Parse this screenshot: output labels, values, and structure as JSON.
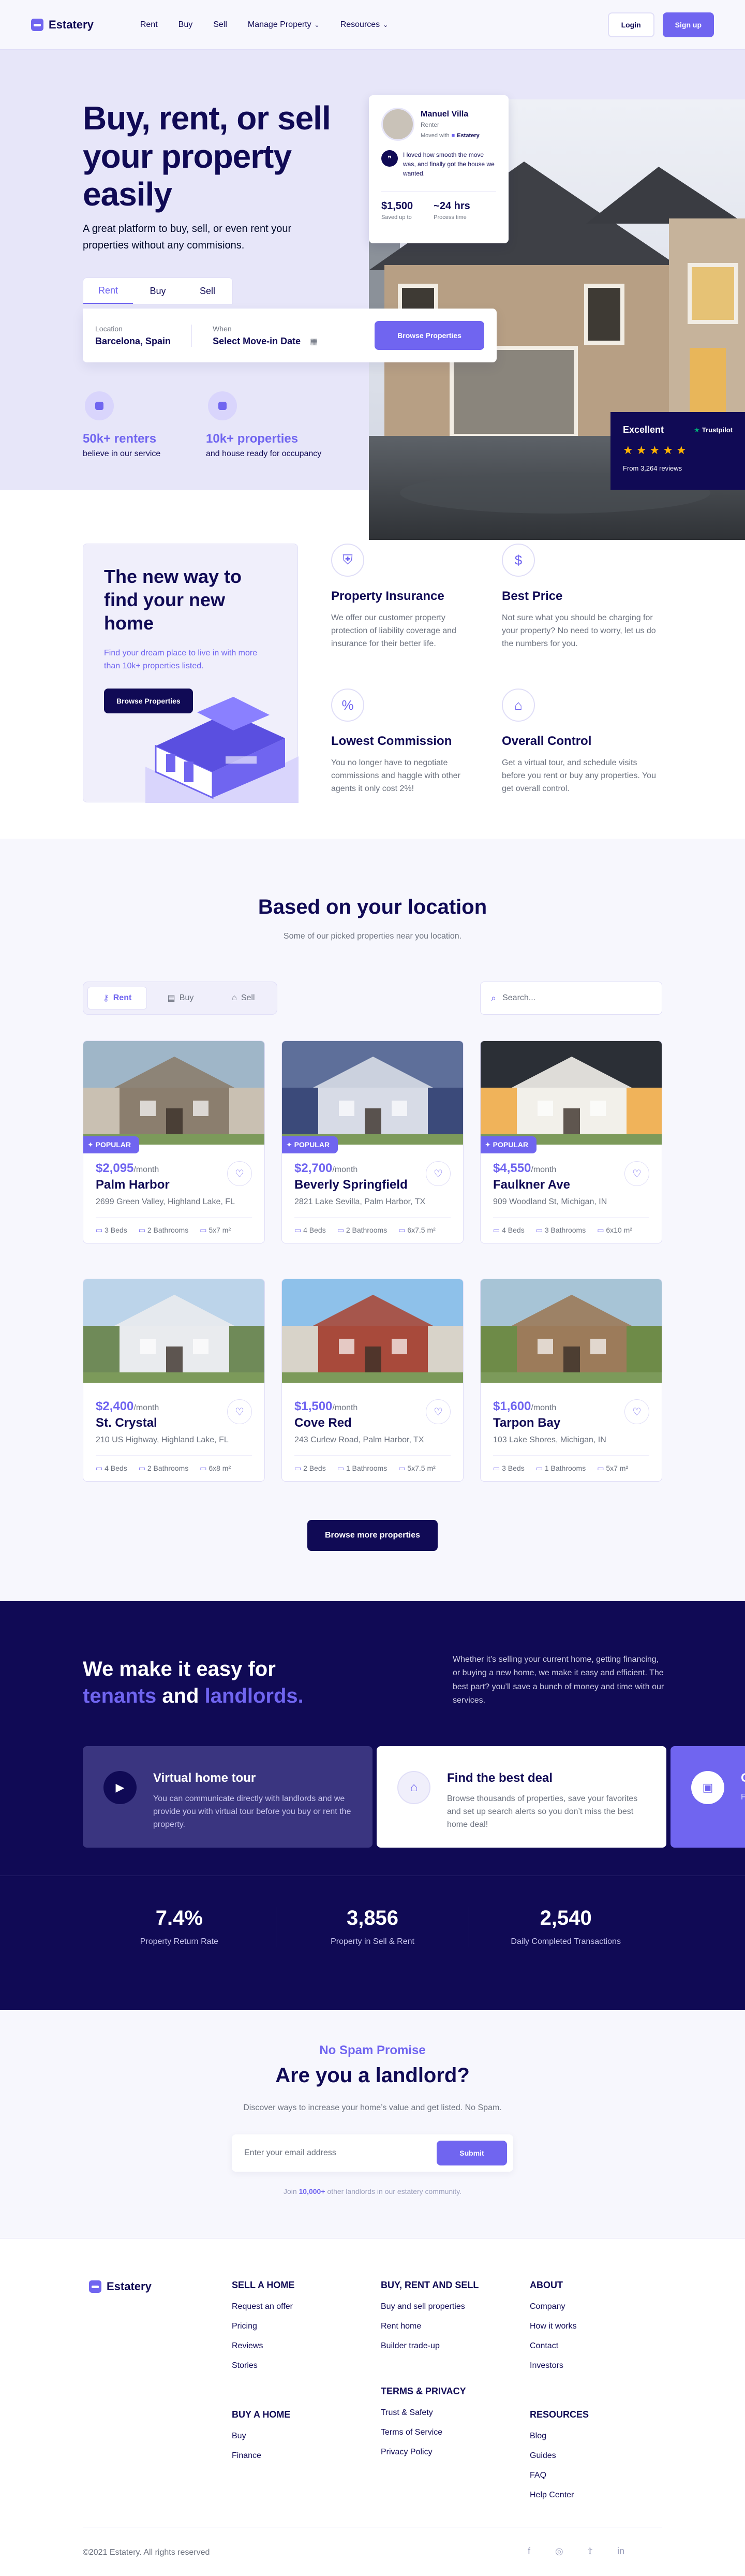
{
  "nav": {
    "brand": "Estatery",
    "links": [
      "Rent",
      "Buy",
      "Sell",
      "Manage Property",
      "Resources"
    ],
    "login": "Login",
    "signup": "Sign up"
  },
  "hero": {
    "title": "Buy, rent, or sell your property easily",
    "subtitle": "A great platform to buy, sell, or even rent your properties without any commisions.",
    "tabs": [
      "Rent",
      "Buy",
      "Sell"
    ],
    "location_label": "Location",
    "location_value": "Barcelona, Spain",
    "when_label": "When",
    "when_value": "Select Move-in Date",
    "browse_btn": "Browse Properties",
    "stats": [
      {
        "value": "50k+ renters",
        "label": "believe in our service"
      },
      {
        "value": "10k+ properties",
        "label": "and house ready for occupancy"
      }
    ],
    "testimonial": {
      "name": "Manuel Villa",
      "role": "Renter",
      "moved_with": "Moved with",
      "moved_brand": "Estatery",
      "quote": "I loved how smooth the move was, and finally got the house we wanted.",
      "saved_value": "$1,500",
      "saved_label": "Saved up to",
      "time_value": "~24 hrs",
      "time_label": "Process time"
    },
    "rating": {
      "label": "Excellent",
      "brand": "Trustpilot",
      "reviews": "From 3,264 reviews",
      "stars": 5
    }
  },
  "features": {
    "promo_title": "The new way to find your new home",
    "promo_desc": "Find your dream place to live in with more than 10k+ properties listed.",
    "promo_btn": "Browse Properties",
    "items": [
      {
        "title": "Property Insurance",
        "desc": "We offer our customer property protection of liability coverage and insurance for their better life."
      },
      {
        "title": "Best Price",
        "desc": "Not sure what you should be charging for your property? No need to worry, let us do the numbers for you."
      },
      {
        "title": "Lowest Commission",
        "desc": "You no longer have to negotiate commissions and haggle with other agents it only cost 2%!"
      },
      {
        "title": "Overall Control",
        "desc": "Get a virtual tour, and schedule visits before you rent or buy any properties. You get overall control."
      }
    ]
  },
  "location": {
    "title": "Based on your location",
    "subtitle": "Some of our picked properties near you location.",
    "tabs": [
      "Rent",
      "Buy",
      "Sell"
    ],
    "search_placeholder": "Search...",
    "popular_label": "POPULAR",
    "per_month": "/month",
    "listings": [
      {
        "price": "$2,095",
        "name": "Palm Harbor",
        "address": "2699 Green Valley, Highland Lake, FL",
        "beds": "3 Beds",
        "baths": "2 Bathrooms",
        "area": "5x7 m²",
        "popular": true
      },
      {
        "price": "$2,700",
        "name": "Beverly Springfield",
        "address": "2821 Lake Sevilla, Palm Harbor, TX",
        "beds": "4 Beds",
        "baths": "2 Bathrooms",
        "area": "6x7.5 m²",
        "popular": true
      },
      {
        "price": "$4,550",
        "name": "Faulkner Ave",
        "address": "909 Woodland St, Michigan, IN",
        "beds": "4 Beds",
        "baths": "3 Bathrooms",
        "area": "6x10 m²",
        "popular": true
      },
      {
        "price": "$2,400",
        "name": "St. Crystal",
        "address": "210 US Highway, Highland Lake, FL",
        "beds": "4 Beds",
        "baths": "2 Bathrooms",
        "area": "6x8 m²",
        "popular": false
      },
      {
        "price": "$1,500",
        "name": "Cove Red",
        "address": "243 Curlew Road, Palm Harbor, TX",
        "beds": "2 Beds",
        "baths": "1 Bathrooms",
        "area": "5x7.5 m²",
        "popular": false
      },
      {
        "price": "$1,600",
        "name": "Tarpon Bay",
        "address": "103 Lake Shores, Michigan, IN",
        "beds": "3 Beds",
        "baths": "1 Bathrooms",
        "area": "5x7 m²",
        "popular": false
      }
    ],
    "more_btn": "Browse more properties"
  },
  "easy": {
    "title_1": "We make it easy for",
    "title_hl1": "tenants",
    "title_and": "and",
    "title_hl2": "landlords.",
    "desc": "Whether it’s selling your current home, getting financing, or buying a new home, we make it easy and efficient. The best part? you’ll save a bunch of money and time with our services.",
    "cards": [
      {
        "title": "Virtual home tour",
        "desc": "You can communicate directly with landlords and we provide you with virtual tour before you buy or rent the property."
      },
      {
        "title": "Find the best deal",
        "desc": "Browse thousands of properties, save your favorites and set up search alerts so you don’t miss the best home deal!"
      },
      {
        "title": "Ge",
        "desc": "Fin"
      }
    ],
    "stats": [
      {
        "value": "7.4%",
        "label": "Property Return Rate"
      },
      {
        "value": "3,856",
        "label": "Property in Sell & Rent"
      },
      {
        "value": "2,540",
        "label": "Daily Completed Transactions"
      }
    ]
  },
  "landlord": {
    "kicker": "No Spam Promise",
    "title": "Are you a landlord?",
    "desc": "Discover ways to increase your home’s value and get listed. No Spam.",
    "placeholder": "Enter your email address",
    "submit": "Submit",
    "join_prefix": "Join",
    "join_count": "10,000+",
    "join_suffix": "other landlords in our estatery community."
  },
  "footer": {
    "brand": "Estatery",
    "cols": [
      {
        "title": "SELL A HOME",
        "items": [
          "Request an offer",
          "Pricing",
          "Reviews",
          "Stories"
        ]
      },
      {
        "title": "BUY, RENT AND SELL",
        "items": [
          "Buy and sell properties",
          "Rent home",
          "Builder trade-up"
        ]
      },
      {
        "title": "ABOUT",
        "items": [
          "Company",
          "How it works",
          "Contact",
          "Investors"
        ]
      },
      {
        "title": "BUY A HOME",
        "items": [
          "Buy",
          "Finance"
        ]
      },
      {
        "title": "TERMS & PRIVACY",
        "items": [
          "Trust & Safety",
          "Terms of Service",
          "Privacy Policy"
        ]
      },
      {
        "title": "RESOURCES",
        "items": [
          "Blog",
          "Guides",
          "FAQ",
          "Help Center"
        ]
      }
    ],
    "copyright": "©2021 Estatery. All rights reserved"
  },
  "colors": {
    "primary": "#7065f0",
    "dark": "#100a55",
    "light": "#e7e6f9"
  }
}
